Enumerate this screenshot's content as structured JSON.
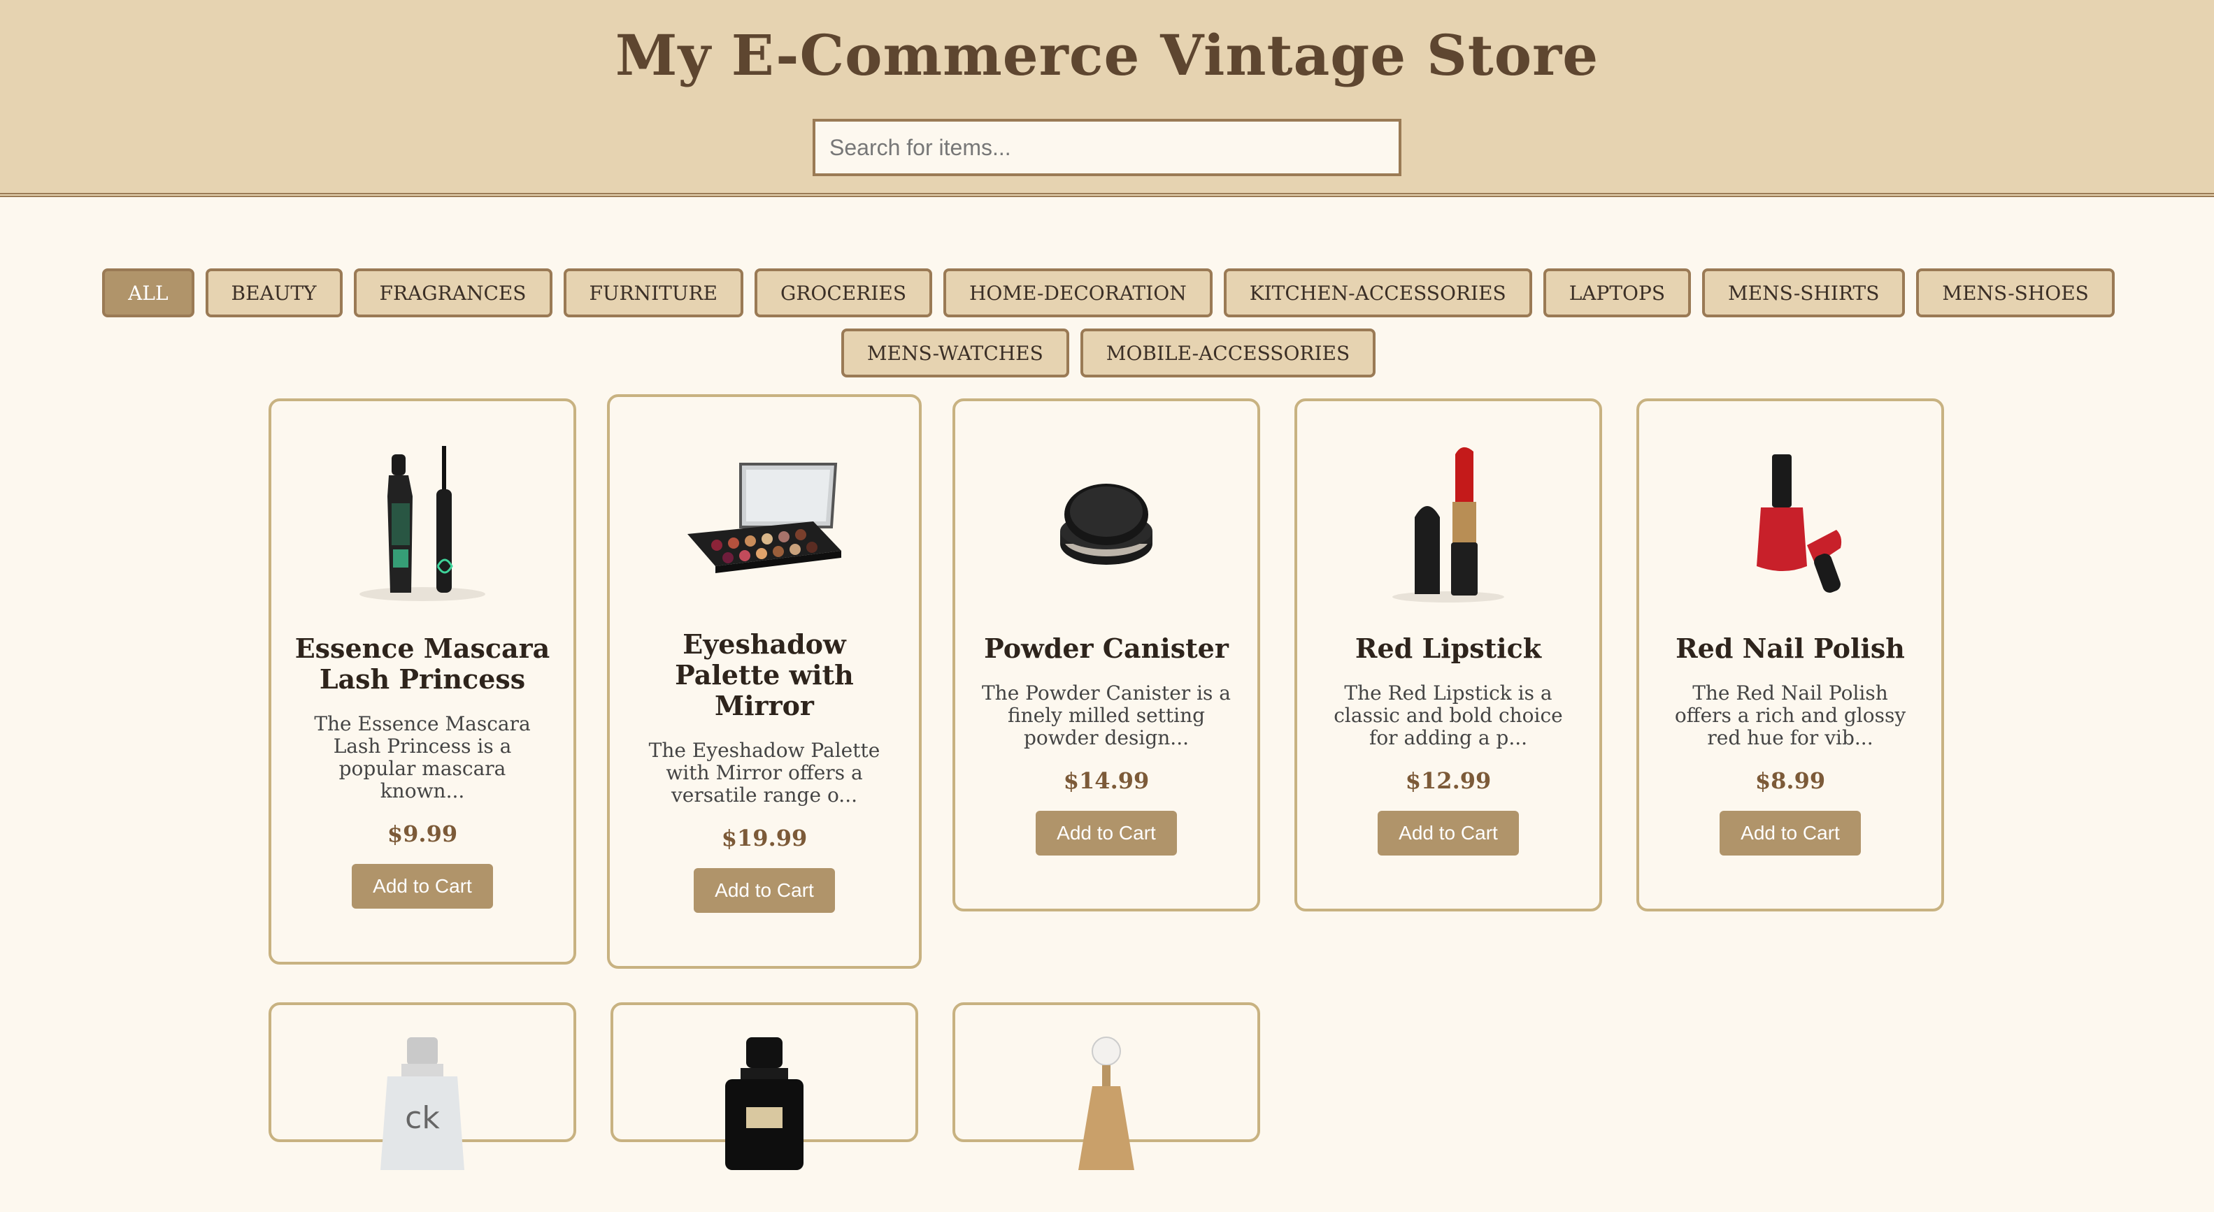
{
  "header": {
    "title": "My E-Commerce Vintage Store",
    "search_placeholder": "Search for items..."
  },
  "categories": [
    {
      "label": "ALL",
      "active": true
    },
    {
      "label": "BEAUTY"
    },
    {
      "label": "FRAGRANCES"
    },
    {
      "label": "FURNITURE"
    },
    {
      "label": "GROCERIES"
    },
    {
      "label": "HOME-DECORATION"
    },
    {
      "label": "KITCHEN-ACCESSORIES"
    },
    {
      "label": "LAPTOPS"
    },
    {
      "label": "MENS-SHIRTS"
    },
    {
      "label": "MENS-SHOES"
    },
    {
      "label": "MENS-WATCHES"
    },
    {
      "label": "MOBILE-ACCESSORIES"
    }
  ],
  "products": [
    {
      "name": "Essence Mascara Lash Princess",
      "description": "The Essence Mascara Lash Princess is a popular mascara known...",
      "price": "$9.99",
      "button": "Add to Cart",
      "image": "mascara-image"
    },
    {
      "name": "Eyeshadow Palette with Mirror",
      "description": "The Eyeshadow Palette with Mirror offers a versatile range o...",
      "price": "$19.99",
      "button": "Add to Cart",
      "image": "eyeshadow-palette-image"
    },
    {
      "name": "Powder Canister",
      "description": "The Powder Canister is a finely milled setting powder design...",
      "price": "$14.99",
      "button": "Add to Cart",
      "image": "powder-canister-image"
    },
    {
      "name": "Red Lipstick",
      "description": "The Red Lipstick is a classic and bold choice for adding a p...",
      "price": "$12.99",
      "button": "Add to Cart",
      "image": "lipstick-image"
    },
    {
      "name": "Red Nail Polish",
      "description": "The Red Nail Polish offers a rich and glossy red hue for vib...",
      "price": "$8.99",
      "button": "Add to Cart",
      "image": "nail-polish-image"
    }
  ],
  "partial_products": [
    {
      "image": "perfume-bottle-image",
      "bottle_text": "ck"
    },
    {
      "image": "perfume-bottle-image"
    },
    {
      "image": "perfume-bottle-image"
    }
  ]
}
